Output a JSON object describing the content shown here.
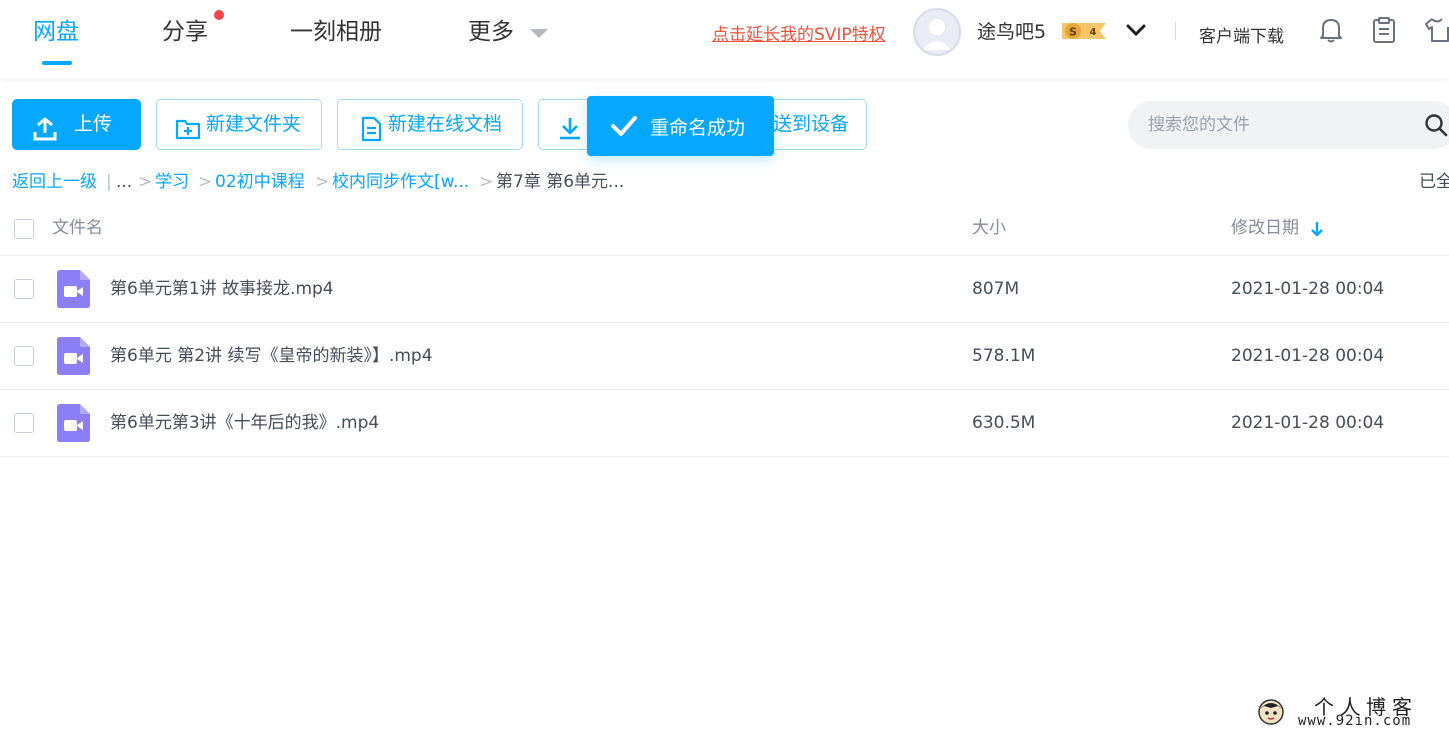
{
  "nav": {
    "tabs": [
      {
        "label": "网盘",
        "active": true
      },
      {
        "label": "分享",
        "has_dot": true
      },
      {
        "label": "一刻相册"
      },
      {
        "label": "更多"
      }
    ],
    "svip_link": "点击延长我的SVIP特权",
    "username": "途鸟吧5",
    "svip_level": "4",
    "client_download": "客户端下载",
    "icons": [
      "bell-icon",
      "clipboard-icon",
      "shirt-icon"
    ]
  },
  "toolbar": {
    "upload_label": "上传",
    "new_folder_label": "新建文件夹",
    "new_doc_label": "新建在线文档",
    "send_device_label": "送到设备",
    "toast_label": "重命名成功",
    "search_placeholder": "搜索您的文件"
  },
  "breadcrumb": {
    "back": "返回上一级",
    "ellipsis": "...",
    "items": [
      "学习",
      "02初中课程",
      "校内同步作文[w..."
    ],
    "current": "第7章 第6单元...",
    "separator": ">",
    "divider": "|",
    "loaded_status": "已全"
  },
  "table": {
    "headers": {
      "name": "文件名",
      "size": "大小",
      "date": "修改日期"
    },
    "sort": "date-desc",
    "rows": [
      {
        "name": "第6单元第1讲 故事接龙.mp4",
        "size": "807M",
        "date": "2021-01-28 00:04"
      },
      {
        "name": "第6单元 第2讲 续写《皇帝的新装》】.mp4",
        "size": "578.1M",
        "date": "2021-01-28 00:04"
      },
      {
        "name": "第6单元第3讲《十年后的我》.mp4",
        "size": "630.5M",
        "date": "2021-01-28 00:04"
      }
    ]
  },
  "watermark": {
    "title": "个人博客",
    "url": "www.92in.com"
  },
  "colors": {
    "accent": "#06a7ff",
    "svip_red": "#f2513a",
    "video_icon": "#8b7ef6",
    "dot": "#f44747"
  }
}
